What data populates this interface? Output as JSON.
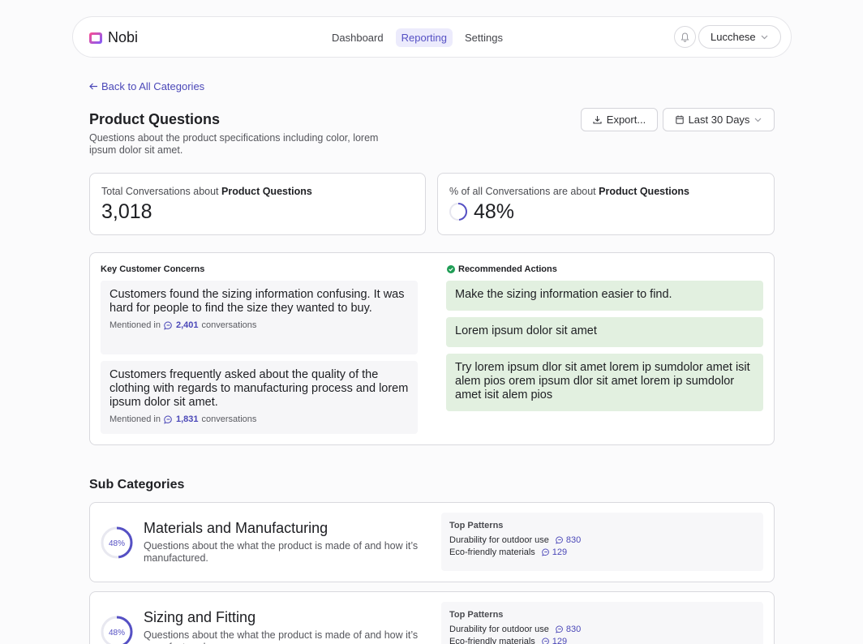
{
  "app": {
    "name": "Nobi"
  },
  "nav": {
    "items": [
      "Dashboard",
      "Reporting",
      "Settings"
    ],
    "active": "Reporting"
  },
  "user": {
    "name": "Lucchese"
  },
  "back_link": "Back to All Categories",
  "page": {
    "title": "Product Questions",
    "description": "Questions about the product specifications including color, lorem ipsum dolor sit amet."
  },
  "toolbar": {
    "export_label": "Export...",
    "date_range_label": "Last 30 Days"
  },
  "stats": {
    "total": {
      "label_prefix": "Total Conversations about ",
      "label_bold": "Product Questions",
      "value": "3,018"
    },
    "share": {
      "label_prefix": "% of all Conversations are about ",
      "label_bold": "Product Questions",
      "value": "48%",
      "fraction": 0.48
    }
  },
  "insights": {
    "concerns_title": "Key Customer Concerns",
    "actions_title": "Recommended Actions",
    "concerns": [
      {
        "text": "Customers found the sizing information confusing. It was hard for people to find the size they wanted to buy.",
        "mentioned_prefix": "Mentioned in",
        "count": "2,401",
        "mentioned_suffix": "conversations"
      },
      {
        "text": "Customers frequently asked about the quality of the clothing with regards to manufacturing process and lorem ipsum dolor sit amet.",
        "mentioned_prefix": "Mentioned in",
        "count": "1,831",
        "mentioned_suffix": "conversations"
      }
    ],
    "actions": [
      "Make the sizing information easier to find.",
      "Lorem ipsum dolor sit amet",
      "Try lorem ipsum dlor sit amet lorem ip sumdolor amet isit alem pios orem ipsum dlor sit amet lorem ip sumdolor amet isit alem pios"
    ]
  },
  "sub_categories": {
    "title": "Sub Categories",
    "patterns_title": "Top Patterns",
    "items": [
      {
        "name": "Materials and Manufacturing",
        "description": "Questions about the what the product is made of and how it’s manufactured.",
        "percent": "48%",
        "fraction": 0.48,
        "patterns": [
          {
            "label": "Durability for outdoor use",
            "count": "830"
          },
          {
            "label": "Eco-friendly materials",
            "count": "129"
          }
        ]
      },
      {
        "name": "Sizing and Fitting",
        "description": "Questions about the what the product is made of and how it’s manufactured.",
        "percent": "48%",
        "fraction": 0.48,
        "patterns": [
          {
            "label": "Durability for outdoor use",
            "count": "830"
          },
          {
            "label": "Eco-friendly materials",
            "count": "129"
          }
        ]
      }
    ]
  },
  "colors": {
    "accent": "#5550c4",
    "action_bg": "#e2f0e0",
    "success": "#1f9d55"
  }
}
